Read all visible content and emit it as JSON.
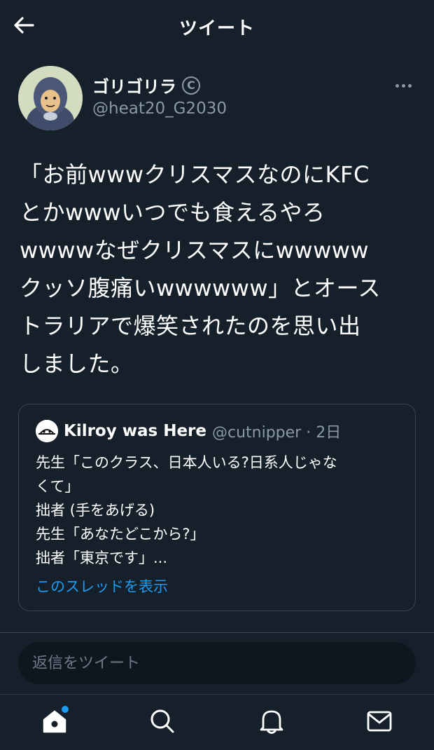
{
  "header": {
    "title": "ツイート",
    "back_icon": "arrow-left-icon"
  },
  "tweet": {
    "author_name": "ゴリゴリラ",
    "author_badge_icon": "copyright-icon",
    "author_badge": "C",
    "author_handle": "@heat20_G2030",
    "more_icon": "more-horizontal-icon",
    "text": "「お前wwwクリスマスなのにKFC\nとかwwwいつでも食えるやろ\nwwwwなぜクリスマスにwwwww\nクッソ腹痛いwwwwww」とオース\nトラリアで爆笑されたのを思い出\nしました。"
  },
  "quote": {
    "avatar_text": "KILROY",
    "name": "Kilroy was Here",
    "handle_time": "@cutnipper · 2日",
    "text": "先生「このクラス、日本人いる?日系人じゃな\nくて」\n拙者 (手をあげる)\n先生「あなたどこから?」\n拙者「東京です」...",
    "link": "このスレッドを表示"
  },
  "reply": {
    "placeholder": "返信をツイート"
  },
  "tabbar": {
    "items": [
      {
        "icon": "home-icon",
        "badge": true
      },
      {
        "icon": "search-icon"
      },
      {
        "icon": "bell-icon"
      },
      {
        "icon": "mail-icon"
      }
    ]
  },
  "colors": {
    "background": "#15202b",
    "accent": "#1d9bf0",
    "secondary_text": "#8b98a5",
    "border": "#38444d"
  }
}
